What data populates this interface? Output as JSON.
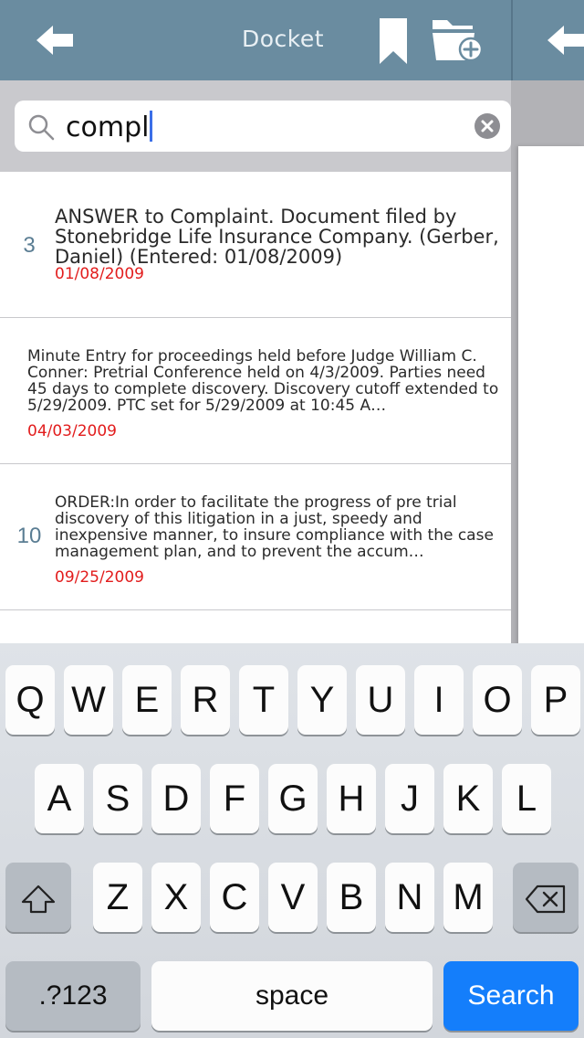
{
  "nav": {
    "title": "Docket"
  },
  "search": {
    "value": "compl"
  },
  "results": [
    {
      "number": "3",
      "description": "ANSWER to Complaint. Document filed by Stonebridge Life Insurance Company. (Gerber, Daniel) (Entered: 01/08/2009)",
      "date": "01/08/2009"
    },
    {
      "number": "",
      "description": "Minute Entry for proceedings held before Judge William C. Conner: Pretrial Conference held on 4/3/2009. Parties need 45 days to complete discovery. Discovery cutoff extended to 5/29/2009. PTC set for 5/29/2009 at 10:45 A…",
      "date": "04/03/2009"
    },
    {
      "number": "10",
      "description": "ORDER:In order to facilitate the progress of pre trial discovery of this litigation in a just, speedy and inexpensive manner, to insure compliance with the case management plan, and to prevent the accum…",
      "date": "09/25/2009"
    }
  ],
  "keyboard": {
    "row1": [
      "Q",
      "W",
      "E",
      "R",
      "T",
      "Y",
      "U",
      "I",
      "O",
      "P"
    ],
    "row2": [
      "A",
      "S",
      "D",
      "F",
      "G",
      "H",
      "J",
      "K",
      "L"
    ],
    "row3": [
      "Z",
      "X",
      "C",
      "V",
      "B",
      "N",
      "M"
    ],
    "numbers_label": ".?123",
    "space_label": "space",
    "search_label": "Search"
  },
  "colors": {
    "navbar": "#6a8ca0",
    "date": "#e21d1d",
    "search_key": "#147efb",
    "caret": "#3b6fe8"
  }
}
